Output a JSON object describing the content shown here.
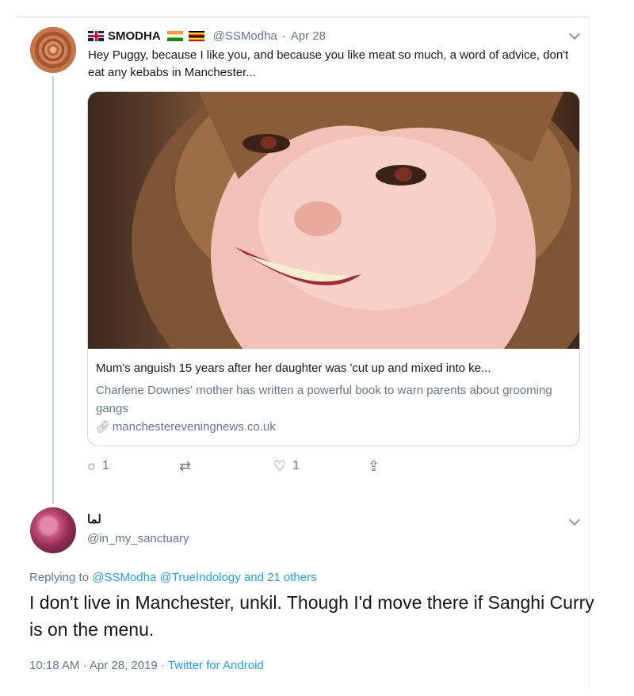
{
  "tweet1": {
    "display_name": "SMODHA",
    "handle": "@SSModha",
    "dot": "·",
    "date": "Apr 28",
    "text": "Hey Puggy, because I like you, and because you like meat so much, a word of advice, don't eat any kebabs in Manchester...",
    "card": {
      "title": "Mum's anguish 15 years after her daughter was 'cut up and mixed into ke...",
      "description": "Charlene Downes' mother has written a powerful book to warn parents about grooming gangs",
      "domain": "manchestereveningnews.co.uk"
    },
    "actions": {
      "reply_count": "1",
      "like_count": "1"
    }
  },
  "tweet2": {
    "display_name": "لما",
    "handle": "@in_my_sanctuary",
    "replying_prefix": "Replying to",
    "replying_to": "@SSModha @TrueIndology and 21 others",
    "text": "I don't live in Manchester, unkil. Though I'd move there if Sanghi Curry is on the menu.",
    "timestamp": "10:18 AM · Apr 28, 2019 ·",
    "source": "Twitter for Android"
  },
  "icons": {
    "reply": "reply-icon",
    "retweet": "retweet-icon",
    "like": "heart-icon",
    "share": "share-icon",
    "link": "link-icon",
    "menu": "chevron-down-icon"
  },
  "colors": {
    "link_blue": "#1da1f2",
    "secondary_text": "#657786",
    "primary_text": "#14171a"
  }
}
